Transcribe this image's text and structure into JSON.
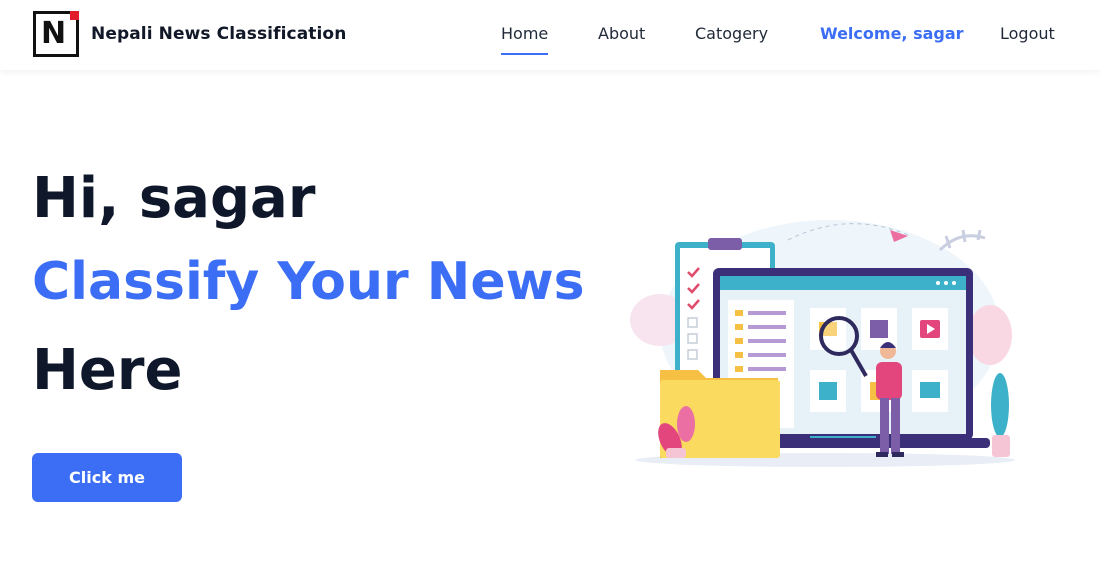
{
  "navbar": {
    "brand": {
      "logo_letter": "N",
      "name": "Nepali News Classification"
    },
    "links": [
      {
        "label": "Home",
        "active": true
      },
      {
        "label": "About",
        "active": false
      },
      {
        "label": "Catogery",
        "active": false
      },
      {
        "label": "Logout",
        "active": false
      }
    ],
    "welcome": "Welcome, sagar"
  },
  "hero": {
    "greeting": "Hi, sagar",
    "headline": "Classify Your News",
    "headline_suffix": "Here",
    "cta_label": "Click me"
  },
  "colors": {
    "accent": "#3b6ef5",
    "heading": "#0f172a",
    "logo_dot": "#e11d2b"
  },
  "illustration": {
    "icons": [
      "email-icon",
      "bookmark-icon",
      "play-icon",
      "lightbulb-icon",
      "note-icon",
      "mail-icon",
      "magnifier-icon"
    ]
  }
}
